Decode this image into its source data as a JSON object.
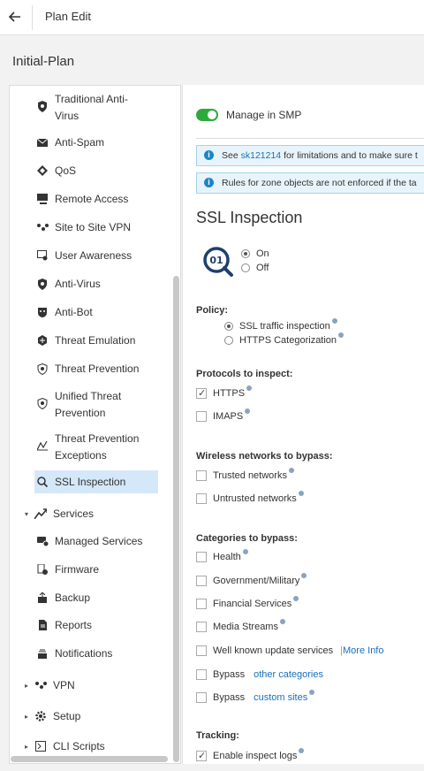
{
  "header": {
    "title": "Plan Edit"
  },
  "plan_name": "Initial-Plan",
  "sidebar": {
    "items": [
      {
        "label": "Traditional Anti-\nVirus"
      },
      {
        "label": "Anti-Spam"
      },
      {
        "label": "QoS"
      },
      {
        "label": "Remote Access"
      },
      {
        "label": "Site to Site VPN"
      },
      {
        "label": "User Awareness"
      },
      {
        "label": "Anti-Virus"
      },
      {
        "label": "Anti-Bot"
      },
      {
        "label": "Threat Emulation"
      },
      {
        "label": "Threat Prevention"
      },
      {
        "label": "Unified Threat\nPrevention"
      },
      {
        "label": "Threat Prevention\nExceptions"
      },
      {
        "label": "SSL Inspection"
      }
    ],
    "services_label": "Services",
    "services_items": [
      {
        "label": "Managed Services"
      },
      {
        "label": "Firmware"
      },
      {
        "label": "Backup"
      },
      {
        "label": "Reports"
      },
      {
        "label": "Notifications"
      }
    ],
    "groups": [
      {
        "label": "VPN"
      },
      {
        "label": "Setup"
      },
      {
        "label": "CLI Scripts"
      }
    ]
  },
  "main": {
    "toggle_label": "Manage in SMP",
    "info1_prefix": "See ",
    "info1_link": "sk121214",
    "info1_suffix": " for limitations and to make sure t",
    "info2": "Rules for zone objects are not enforced if the ta",
    "title": "SSL Inspection",
    "logo_text": "01",
    "state_on": "On",
    "state_off": "Off",
    "policy_title": "Policy:",
    "policy_opt1": "SSL traffic inspection",
    "policy_opt2": "HTTPS Categorization",
    "protocols_title": "Protocols to inspect:",
    "proto_https": "HTTPS",
    "proto_imaps": "IMAPS",
    "wireless_title": "Wireless networks to bypass:",
    "wireless_trusted": "Trusted networks",
    "wireless_untrusted": "Untrusted networks",
    "categories_title": "Categories to bypass:",
    "cat_health": "Health",
    "cat_gov": "Government/Military",
    "cat_fin": "Financial Services",
    "cat_media": "Media Streams",
    "cat_update": "Well known update services",
    "more_info": "More Info",
    "bypass_label": "Bypass",
    "bypass_other": "other categories",
    "bypass_custom": "custom sites",
    "tracking_title": "Tracking:",
    "tracking_logs": "Enable inspect logs"
  }
}
